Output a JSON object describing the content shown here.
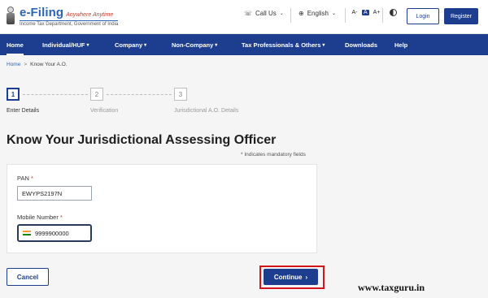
{
  "header": {
    "logo_title": "e-Filing",
    "logo_tagline": "Anywhere Anytime",
    "logo_department": "Income Tax Department, Government of India",
    "call_us": "Call Us",
    "language": "English",
    "font_sizes": [
      "A-",
      "A",
      "A+"
    ],
    "login": "Login",
    "register": "Register"
  },
  "nav": {
    "items": [
      {
        "label": "Home"
      },
      {
        "label": "Individual/HUF"
      },
      {
        "label": "Company"
      },
      {
        "label": "Non-Company"
      },
      {
        "label": "Tax Professionals & Others"
      },
      {
        "label": "Downloads"
      },
      {
        "label": "Help"
      }
    ]
  },
  "breadcrumb": {
    "home": "Home",
    "separator": ">",
    "current": "Know Your A.O."
  },
  "stepper": {
    "steps": [
      {
        "number": "1",
        "label": "Enter Details"
      },
      {
        "number": "2",
        "label": "Verification"
      },
      {
        "number": "3",
        "label": "Jurisdictional A.O. Details"
      }
    ]
  },
  "page": {
    "title": "Know Your Jurisdictional Assessing Officer",
    "mandatory_note": "* Indicates mandatory fields"
  },
  "form": {
    "pan_label": "PAN",
    "pan_value": "EWYPS2197N",
    "mobile_label": "Mobile Number",
    "mobile_value": "9999900000",
    "required_mark": "*"
  },
  "actions": {
    "cancel": "Cancel",
    "continue": "Continue",
    "continue_arrow": "›"
  },
  "watermark": "www.taxguru.in",
  "colors": {
    "primary": "#1d3e8e",
    "highlight": "#d4141a"
  }
}
